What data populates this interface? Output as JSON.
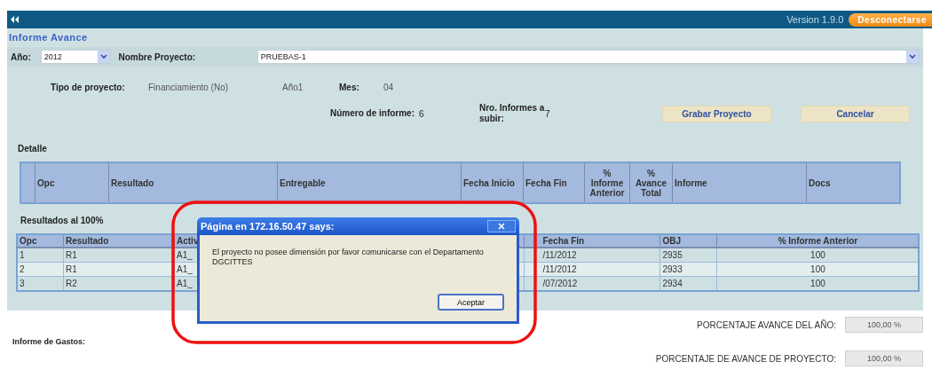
{
  "header": {
    "version": "Version 1.9.0",
    "logout_button": "Desconectarse"
  },
  "page_title": "Informe Avance",
  "filters": {
    "year_label": "Año:",
    "year": "2012",
    "project_label": "Nombre Proyecto:",
    "project": "PRUEBAS-1"
  },
  "info": {
    "type_label": "Tipo de proyecto:",
    "type_value": "Financiamiento (No)",
    "year_text": "Año1",
    "month_label": "Mes:",
    "month_value": "04"
  },
  "counts": [
    {
      "label": "Número de informe:",
      "value": "6"
    },
    {
      "label": "Nro. Informes a subir:",
      "value": "7"
    }
  ],
  "buttons": [
    "Grabar Proyecto",
    "Cancelar"
  ],
  "detail": {
    "title": "Detalle",
    "columns": [
      "Opc",
      "Resultado",
      "Entregable",
      "Fecha Inicio",
      "Fecha Fin",
      "% Informe Anterior",
      "% Avance Total",
      "Informe",
      "Docs"
    ]
  },
  "results": {
    "title": "Resultados al 100%",
    "columns": [
      "Opc",
      "Resultado",
      "Activ",
      "Fecha Fin",
      "OBJ",
      "% Informe Anterior"
    ],
    "rows": [
      [
        "1",
        "R1",
        "A1_",
        "/11/2012",
        "2935",
        "100"
      ],
      [
        "2",
        "R1",
        "A1_",
        "/11/2012",
        "2933",
        "100"
      ],
      [
        "3",
        "R2",
        "A1_",
        "/07/2012",
        "2934",
        "100"
      ]
    ]
  },
  "dialog": {
    "title": "Página en 172.16.50.47 says:",
    "message": "El proyecto no posee dimensión por favor comunicarse con el Departamento DGCITTES",
    "button": "Aceptar"
  },
  "totals": [
    {
      "label": "PORCENTAJE  AVANCE DEL AÑO:",
      "value": "100,00 %"
    },
    {
      "label": "PORCENTAJE DE AVANCE DE PROYECTO:",
      "value": "100,00 %"
    }
  ],
  "expenses_title": "Informe de Gastos:"
}
